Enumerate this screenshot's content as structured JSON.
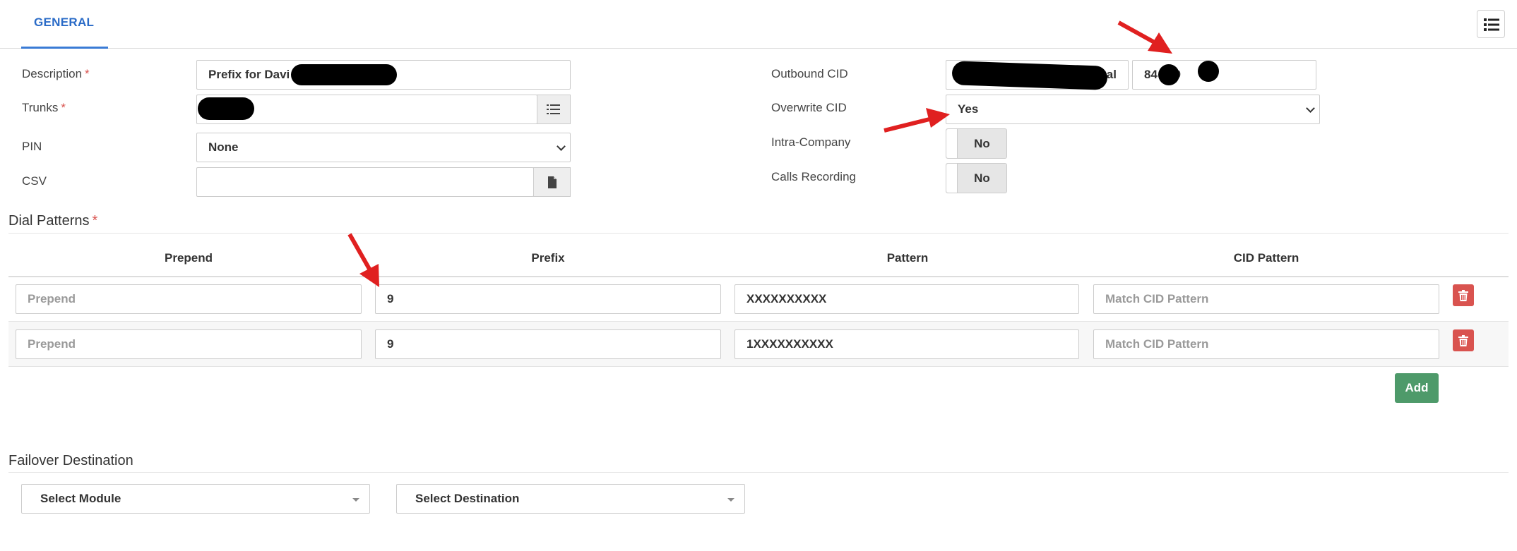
{
  "tabs": [
    {
      "label": "GENERAL",
      "active": true
    }
  ],
  "form": {
    "description": {
      "label": "Description",
      "value": "Prefix for Davi",
      "required": true
    },
    "trunks": {
      "label": "Trunks",
      "required": true
    },
    "pin": {
      "label": "PIN",
      "value": "None"
    },
    "csv": {
      "label": "CSV",
      "value": ""
    },
    "outbound_cid": {
      "label": "Outbound CID",
      "name_value": "Sal",
      "number_value": "84 339"
    },
    "overwrite_cid": {
      "label": "Overwrite CID",
      "value": "Yes"
    },
    "intra_company": {
      "label": "Intra-Company",
      "value": "No"
    },
    "calls_recording": {
      "label": "Calls Recording",
      "value": "No"
    }
  },
  "dial_patterns": {
    "title": "Dial Patterns",
    "required": true,
    "columns": [
      "Prepend",
      "Prefix",
      "Pattern",
      "CID Pattern"
    ],
    "rows": [
      {
        "prepend": "",
        "prepend_placeholder": "Prepend",
        "prefix": "9",
        "pattern": "XXXXXXXXXX",
        "cid_pattern": "",
        "cid_placeholder": "Match CID Pattern"
      },
      {
        "prepend": "",
        "prepend_placeholder": "Prepend",
        "prefix": "9",
        "pattern": "1XXXXXXXXXX",
        "cid_pattern": "",
        "cid_placeholder": "Match CID Pattern"
      }
    ],
    "add_label": "Add"
  },
  "failover": {
    "title": "Failover Destination",
    "module_placeholder": "Select Module",
    "destination_placeholder": "Select Destination"
  },
  "icons": {
    "menu": "list-icon",
    "trunks_addon": "list-icon",
    "csv_addon": "file-icon",
    "delete": "trash-icon"
  },
  "colors": {
    "accent": "#2a6bc7",
    "required": "#d9534f",
    "delete": "#d9534f",
    "add": "#4e9a6a",
    "annotation_arrow": "#e02020"
  }
}
